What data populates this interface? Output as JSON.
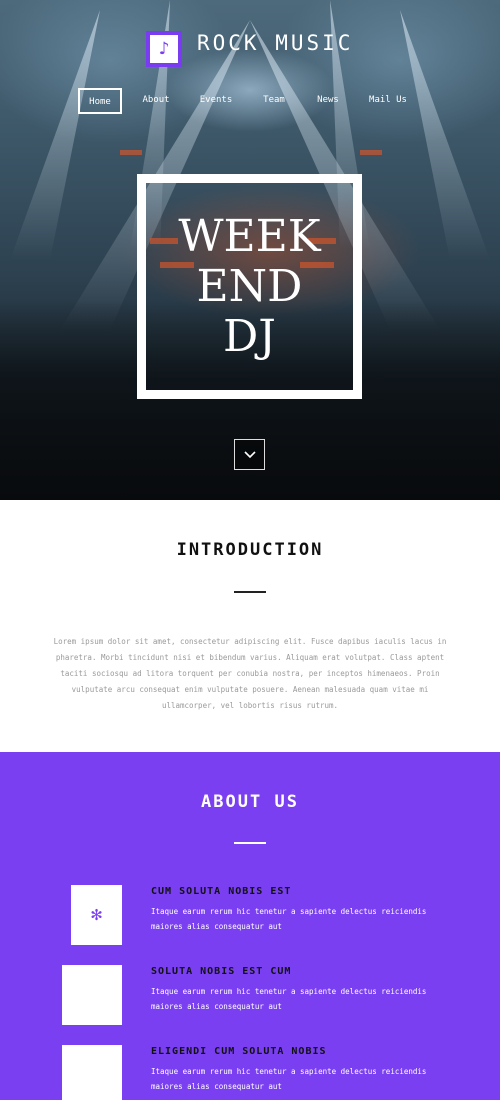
{
  "header": {
    "brand": "ROCK MUSIC",
    "logo_icon": "music-note-icon"
  },
  "nav": {
    "items": [
      {
        "label": "Home",
        "active": true
      },
      {
        "label": "About",
        "active": false
      },
      {
        "label": "Events",
        "active": false
      },
      {
        "label": "Team",
        "active": false
      },
      {
        "label": "News",
        "active": false
      },
      {
        "label": "Mail Us",
        "active": false
      }
    ]
  },
  "hero": {
    "line1": "WEEK",
    "line2": "END",
    "line3": "DJ",
    "scroll_icon": "chevron-down-icon"
  },
  "intro": {
    "title": "INTRODUCTION",
    "text": "Lorem ipsum dolor sit amet, consectetur adipiscing elit. Fusce dapibus iaculis lacus in pharetra. Morbi tincidunt nisi et bibendum varius. Aliquam erat volutpat. Class aptent taciti sociosqu ad litora torquent per conubia nostra, per inceptos himenaeos. Proin vulputate arcu consequat enim vulputate posuere. Aenean malesuada quam vitae mi ullamcorper, vel lobortis risus rutrum."
  },
  "about": {
    "title": "ABOUT US",
    "features": [
      {
        "title": "CUM SOLUTA NOBIS EST",
        "desc": "Itaque earum rerum hic tenetur a sapiente delectus reiciendis maiores alias consequatur aut",
        "icon": "asterisk-icon"
      },
      {
        "title": "SOLUTA NOBIS EST CUM",
        "desc": "Itaque earum rerum hic tenetur a sapiente delectus reiciendis maiores alias consequatur aut",
        "icon": ""
      },
      {
        "title": "ELIGENDI CUM SOLUTA NOBIS",
        "desc": "Itaque earum rerum hic tenetur a sapiente delectus reiciendis maiores alias consequatur aut",
        "icon": ""
      }
    ]
  },
  "colors": {
    "accent": "#7b3ff2",
    "white": "#ffffff"
  }
}
